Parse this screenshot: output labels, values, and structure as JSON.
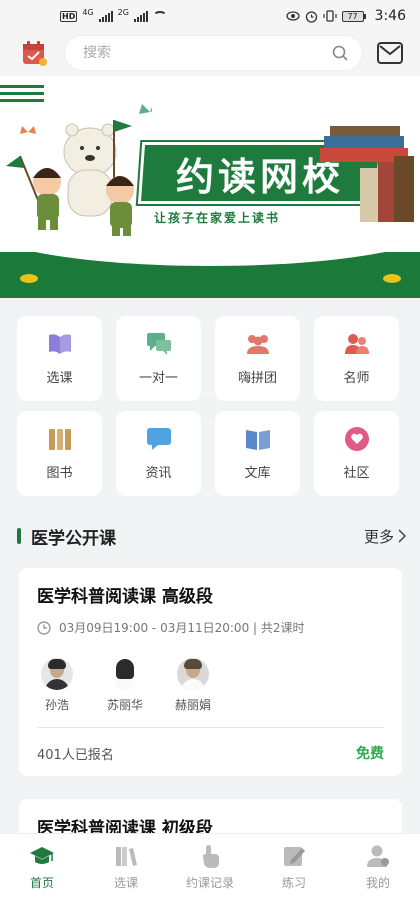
{
  "status_bar": {
    "hd_tag": "HD",
    "net_1": "4G",
    "net_2": "2G",
    "battery": "77",
    "time": "3:46"
  },
  "header": {
    "search_placeholder": "搜索"
  },
  "banner": {
    "title": "约读网校",
    "slogan": "让孩子在家爱上读书"
  },
  "grid": [
    {
      "label": "选课",
      "icon": "open-book-icon",
      "color": "#8b7fd9"
    },
    {
      "label": "一对一",
      "icon": "chat-bubbles-icon",
      "color": "#5fae8a"
    },
    {
      "label": "嗨拼团",
      "icon": "group-icon",
      "color": "#e0786b"
    },
    {
      "label": "名师",
      "icon": "teachers-icon",
      "color": "#e05a4f"
    },
    {
      "label": "图书",
      "icon": "books-icon",
      "color": "#c79a5c"
    },
    {
      "label": "资讯",
      "icon": "message-icon",
      "color": "#4fa3e0"
    },
    {
      "label": "文库",
      "icon": "library-book-icon",
      "color": "#5b86c9"
    },
    {
      "label": "社区",
      "icon": "heart-chat-icon",
      "color": "#e05a86"
    }
  ],
  "section": {
    "title": "医学公开课",
    "more": "更多"
  },
  "courses": [
    {
      "title": "医学科普阅读课  高级段",
      "time": "03月09日19:00 - 03月11日20:00 | 共2课时",
      "teachers": [
        "孙浩",
        "苏丽华",
        "赫丽娟"
      ],
      "enrolled": "401人已报名",
      "price": "免费"
    },
    {
      "title": "医学科普阅读课 初级段"
    }
  ],
  "tabs": [
    {
      "label": "首页",
      "icon": "graduation-cap-icon",
      "active": true
    },
    {
      "label": "选课",
      "icon": "books-icon",
      "active": false
    },
    {
      "label": "约课记录",
      "icon": "hand-tap-icon",
      "active": false
    },
    {
      "label": "练习",
      "icon": "edit-icon",
      "active": false
    },
    {
      "label": "我的",
      "icon": "user-icon",
      "active": false
    }
  ],
  "colors": {
    "brand_green": "#1f7a3e",
    "price_green": "#2fa84f",
    "background": "#f2f3f5"
  }
}
